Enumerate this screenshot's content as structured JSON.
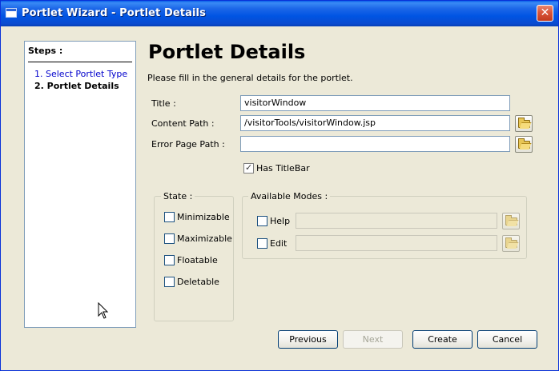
{
  "window": {
    "title": "Portlet Wizard - Portlet Details",
    "close_glyph": "✕"
  },
  "steps": {
    "header": "Steps :",
    "items": [
      "1. Select Portlet Type",
      "2. Portlet Details"
    ]
  },
  "main": {
    "title": "Portlet Details",
    "description": "Please fill in the general details for the portlet."
  },
  "fields": {
    "title_label": "Title :",
    "title_value": "visitorWindow",
    "content_path_label": "Content Path :",
    "content_path_value": "/visitorTools/visitorWindow.jsp",
    "error_page_label": "Error Page Path :",
    "error_page_value": ""
  },
  "has_titlebar": {
    "label": "Has TitleBar",
    "checked": true
  },
  "state": {
    "legend": "State :",
    "options": [
      "Minimizable",
      "Maximizable",
      "Floatable",
      "Deletable"
    ]
  },
  "modes": {
    "legend": "Available Modes :",
    "help_label": "Help",
    "edit_label": "Edit"
  },
  "buttons": {
    "previous": "Previous",
    "next": "Next",
    "create": "Create",
    "cancel": "Cancel"
  }
}
